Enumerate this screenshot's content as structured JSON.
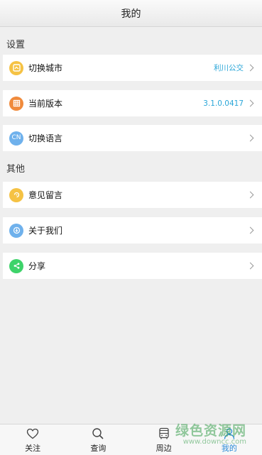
{
  "header": {
    "title": "我的"
  },
  "sections": [
    {
      "label": "设置",
      "items": [
        {
          "label": "切换城市",
          "value": "利川公交",
          "icon": "map-icon",
          "color": "#f5c244"
        },
        {
          "label": "当前版本",
          "value": "3.1.0.0417",
          "icon": "version-icon",
          "color": "#f08a3b"
        },
        {
          "label": "切换语言",
          "value": "",
          "icon_text": "CN",
          "icon": "language-icon",
          "color": "#6fb1ec"
        }
      ]
    },
    {
      "label": "其他",
      "items": [
        {
          "label": "意见留言",
          "value": "",
          "icon": "feedback-icon",
          "color": "#f5c244"
        },
        {
          "label": "关于我们",
          "value": "",
          "icon": "about-icon",
          "color": "#6fb1ec"
        },
        {
          "label": "分享",
          "value": "",
          "icon": "share-icon",
          "color": "#3ed36a"
        }
      ]
    }
  ],
  "tabs": [
    {
      "label": "关注",
      "icon": "heart-icon",
      "active": false
    },
    {
      "label": "查询",
      "icon": "search-icon",
      "active": false
    },
    {
      "label": "周边",
      "icon": "bus-icon",
      "active": false
    },
    {
      "label": "我的",
      "icon": "person-icon",
      "active": true
    }
  ],
  "watermark": {
    "text": "绿色资源网",
    "url": "www.downcc.com"
  },
  "colors": {
    "accent": "#2aa6d8",
    "tab_active": "#2a8ad8",
    "background": "#efefef"
  }
}
